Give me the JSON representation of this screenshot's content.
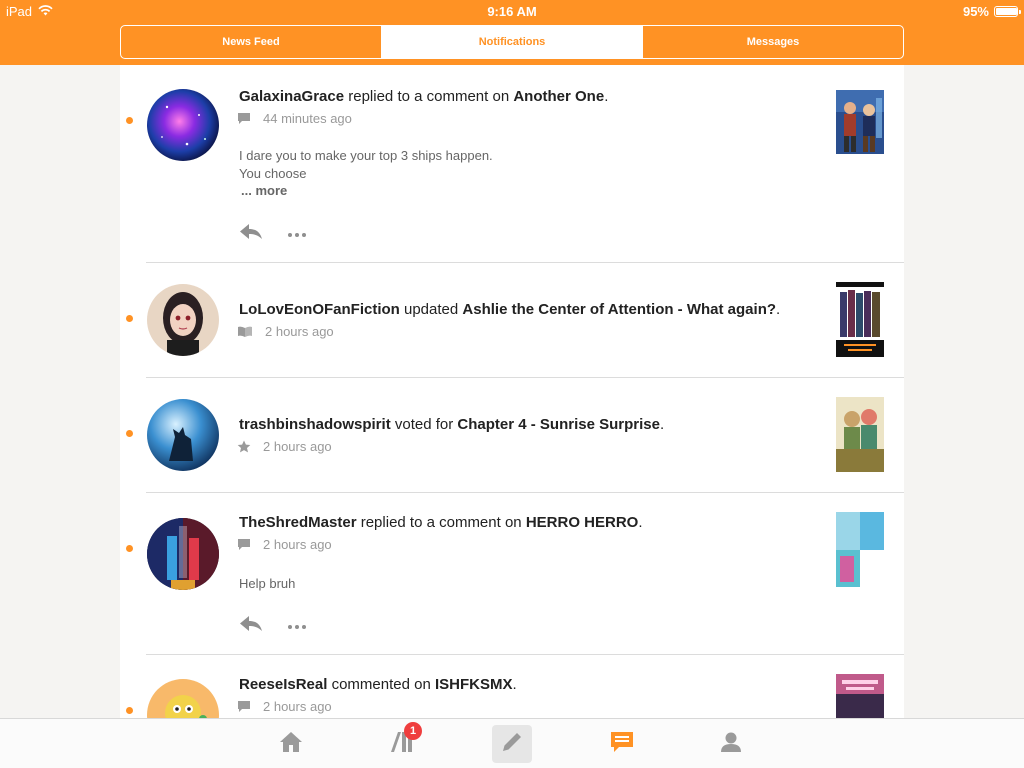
{
  "status_bar": {
    "device": "iPad",
    "time": "9:16 AM",
    "battery": "95%",
    "battery_level": 0.95
  },
  "tabs": [
    {
      "label": "News Feed",
      "active": false
    },
    {
      "label": "Notifications",
      "active": true
    },
    {
      "label": "Messages",
      "active": false
    }
  ],
  "notifications": [
    {
      "user": "GalaxinaGrace",
      "action": "replied to a comment on",
      "target": "Another One",
      "end": ".",
      "meta_icon": "comment-icon",
      "time": "44 minutes ago",
      "body_line1": "I dare you to make your top 3 ships happen.",
      "body_line2": "You choose",
      "more": "... more"
    },
    {
      "user": "LoLovEonOFanFiction",
      "action": "updated",
      "target": "Ashlie the Center of Attention - What again?",
      "end": ".",
      "meta_icon": "book-icon",
      "time": "2 hours ago"
    },
    {
      "user": "trashbinshadowspirit",
      "action": "voted for",
      "target": "Chapter 4 - Sunrise Surprise",
      "end": ".",
      "meta_icon": "star-icon",
      "time": "2 hours ago"
    },
    {
      "user": "TheShredMaster",
      "action": "replied to a comment on",
      "target": "HERRO HERRO",
      "end": ".",
      "meta_icon": "comment-icon",
      "time": "2 hours ago",
      "body_line1": "Help bruh"
    },
    {
      "user": "ReeseIsReal",
      "action": "commented on",
      "target": "ISHFKSMX",
      "end": ".",
      "meta_icon": "comment-icon",
      "time": "2 hours ago"
    }
  ],
  "tabbar": {
    "items": [
      "home-icon",
      "library-icon",
      "write-icon",
      "notifications-icon",
      "profile-icon"
    ],
    "library_badge": "1",
    "active": "notifications-icon"
  },
  "colors": {
    "accent": "#ff9224",
    "badge": "#ef3e3e"
  }
}
